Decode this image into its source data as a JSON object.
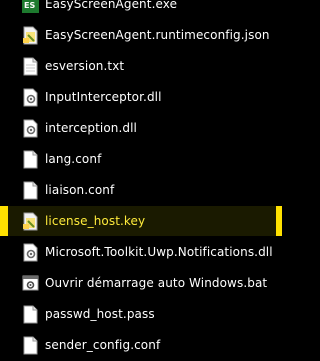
{
  "colors": {
    "background": "#000000",
    "text": "#ffffff",
    "highlight": "#ffe100",
    "highlight_text": "#ffeb3b"
  },
  "files": [
    {
      "name": "EasyScreenAgent.exe",
      "icon": "app-exe-icon",
      "highlighted": false
    },
    {
      "name": "EasyScreenAgent.runtimeconfig.json",
      "icon": "json-file-icon",
      "highlighted": false
    },
    {
      "name": "esversion.txt",
      "icon": "text-file-icon",
      "highlighted": false
    },
    {
      "name": "InputInterceptor.dll",
      "icon": "dll-file-icon",
      "highlighted": false
    },
    {
      "name": "interception.dll",
      "icon": "dll-file-icon",
      "highlighted": false
    },
    {
      "name": "lang.conf",
      "icon": "blank-file-icon",
      "highlighted": false
    },
    {
      "name": "liaison.conf",
      "icon": "blank-file-icon",
      "highlighted": false
    },
    {
      "name": "license_host.key",
      "icon": "key-file-icon",
      "highlighted": true
    },
    {
      "name": "Microsoft.Toolkit.Uwp.Notifications.dll",
      "icon": "dll-file-icon",
      "highlighted": false
    },
    {
      "name": "Ouvrir démarrage auto Windows.bat",
      "icon": "batch-file-icon",
      "highlighted": false
    },
    {
      "name": "passwd_host.pass",
      "icon": "blank-file-icon",
      "highlighted": false
    },
    {
      "name": "sender_config.conf",
      "icon": "blank-file-icon",
      "highlighted": false
    }
  ]
}
